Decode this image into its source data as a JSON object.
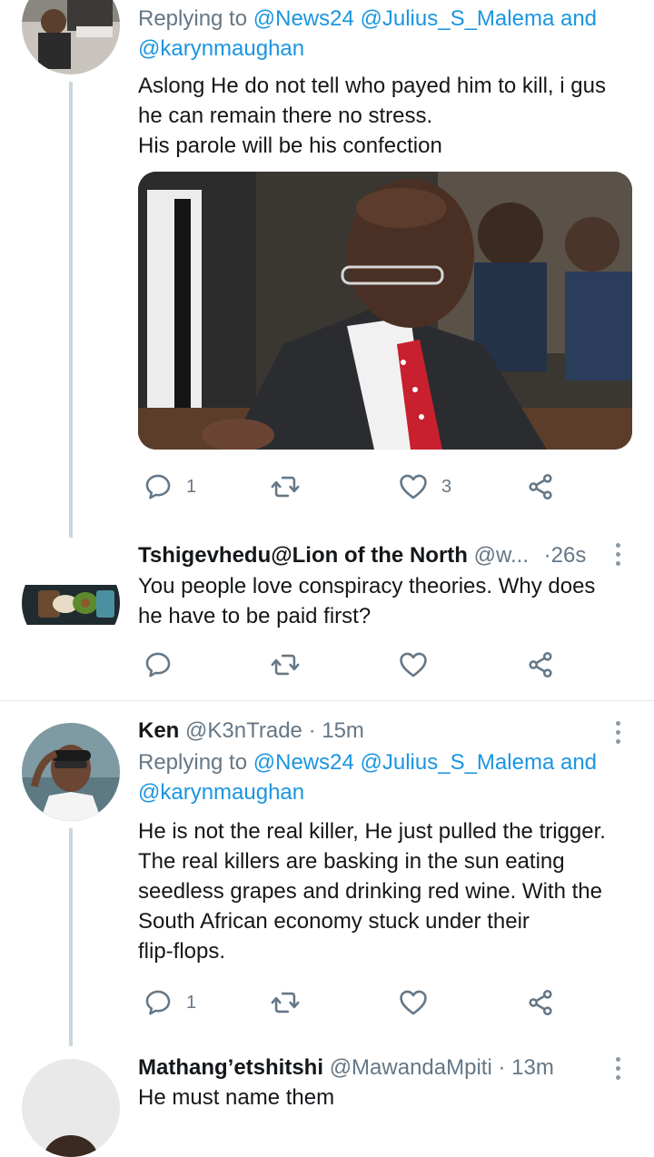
{
  "colors": {
    "accent": "#1b95e0",
    "muted": "#657786",
    "text": "#14171a",
    "line": "#ccd6dd"
  },
  "tweet1": {
    "replying_prefix": "Replying to",
    "mentions": [
      "@News24",
      "@Julius_S_Malema"
    ],
    "and": "and",
    "mention_last": "@karynmaughan",
    "text_lines": [
      "Aslong He do not tell who payed him to kill, i gus",
      "he can remain there no stress.",
      "His parole will be his confection"
    ],
    "reply_count": "1",
    "like_count": "3"
  },
  "tweet2": {
    "name": "Tshigevhedu@Lion of the North",
    "handle": "@w...",
    "dot": "·",
    "time": "26s",
    "text_lines": [
      "You people love conspiracy theories. Why does",
      "he have to be paid first?"
    ]
  },
  "tweet3": {
    "name": "Ken",
    "handle": "@K3nTrade",
    "dot": "·",
    "time": "15m",
    "replying_prefix": "Replying to",
    "mentions": [
      "@News24",
      "@Julius_S_Malema"
    ],
    "and": "and",
    "mention_last": "@karynmaughan",
    "text_lines": [
      "He is not the real killer, He just pulled the trigger.",
      "The real killers are basking in the sun eating",
      "seedless grapes and drinking red wine. With the",
      "South African economy stuck under their",
      "flip-flops."
    ],
    "reply_count": "1"
  },
  "tweet4": {
    "name": "Mathang’etshitshi",
    "handle": "@MawandaMpiti",
    "dot": "·",
    "time": "13m",
    "text_lines": [
      "He must name them"
    ]
  },
  "icons": [
    "reply-icon",
    "retweet-icon",
    "like-icon",
    "share-icon",
    "more-icon"
  ]
}
